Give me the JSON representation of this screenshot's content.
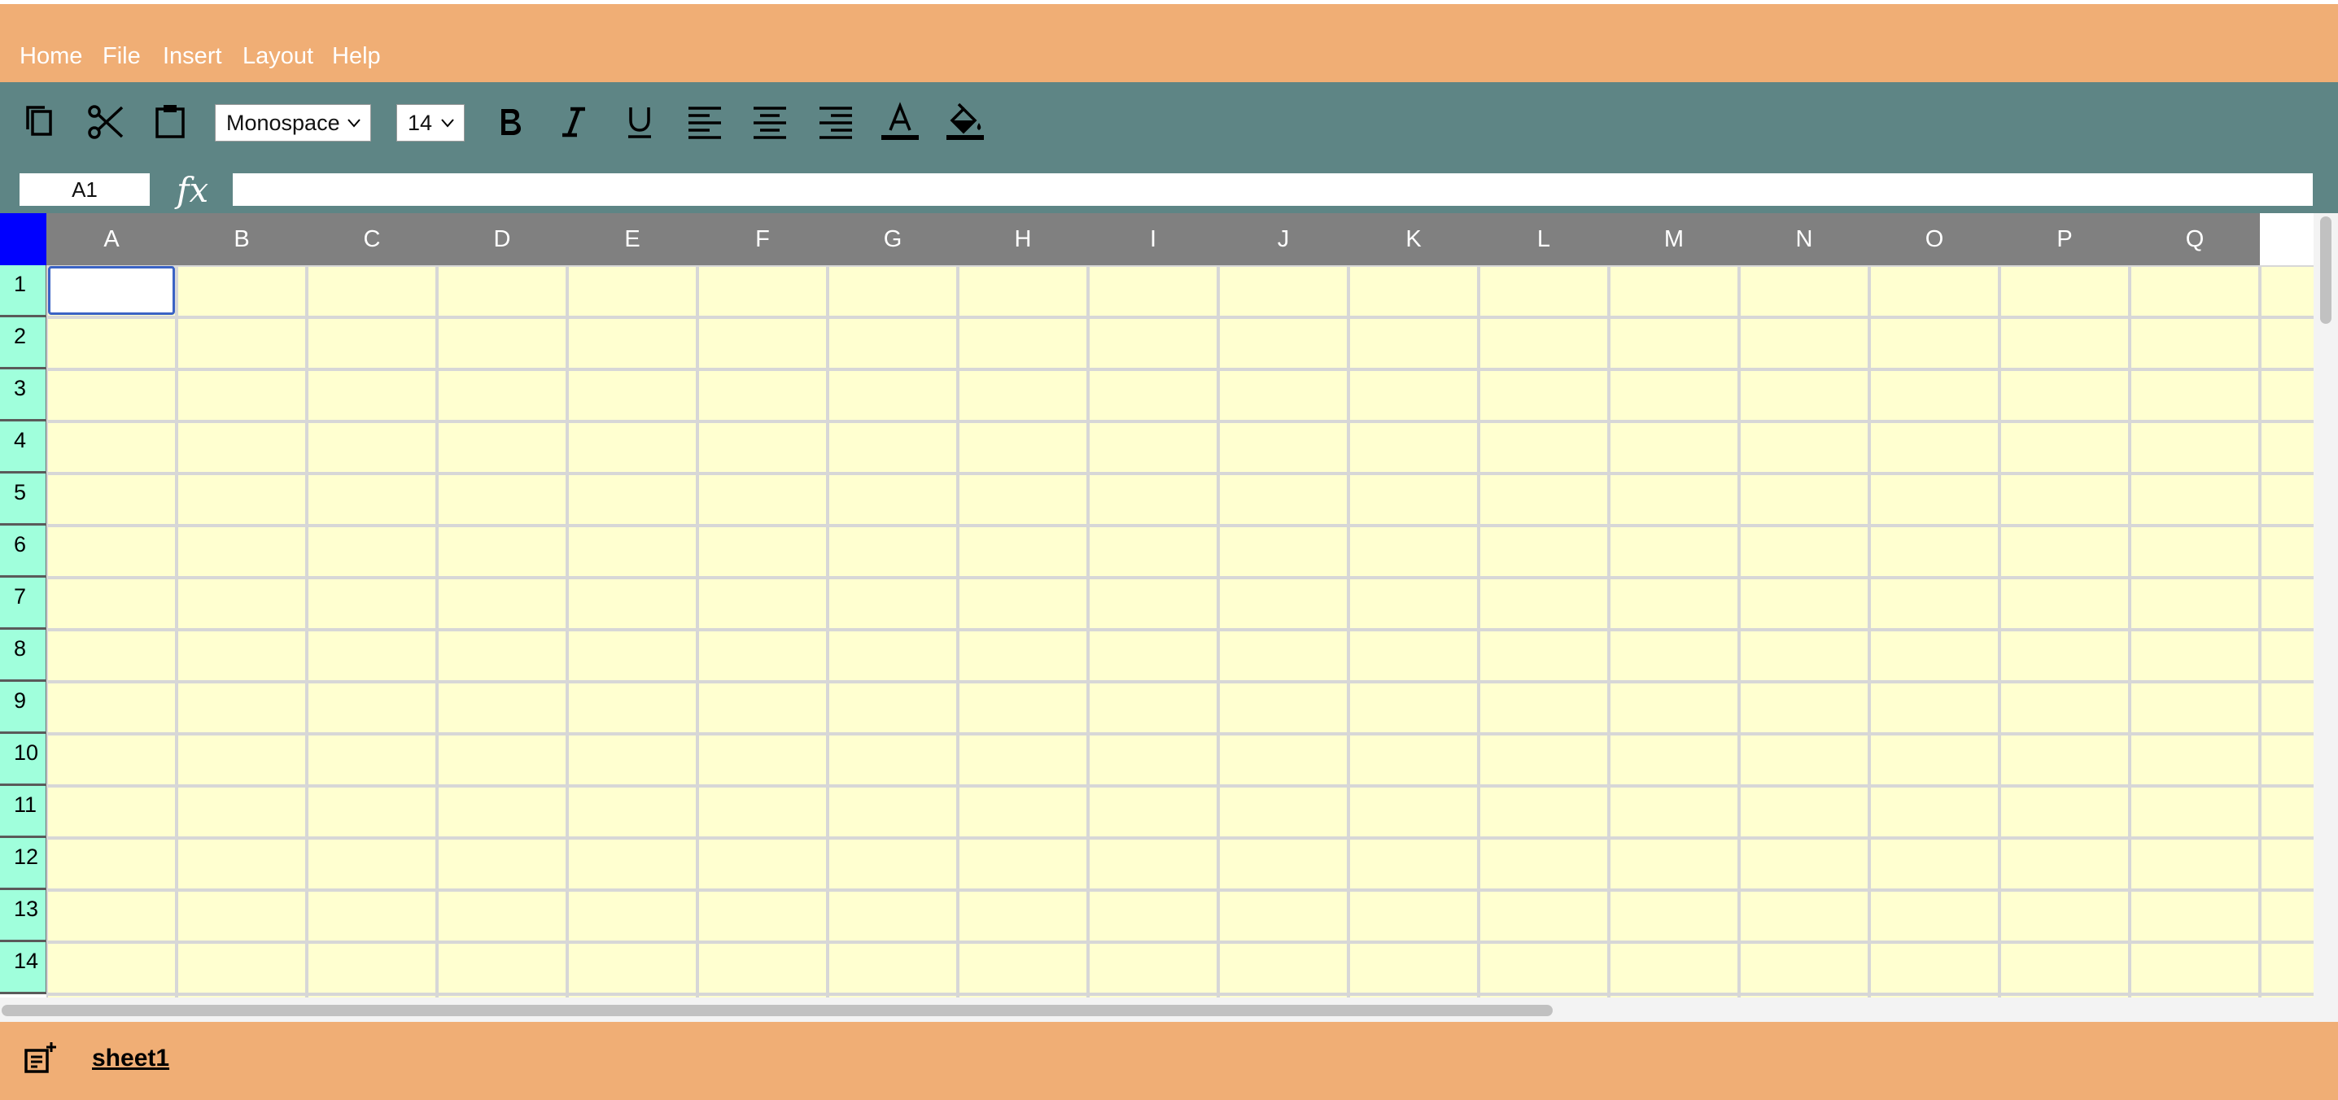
{
  "menu": {
    "items": [
      "Home",
      "File",
      "Insert",
      "Layout",
      "Help"
    ]
  },
  "toolbar": {
    "font_family": "Monospace",
    "font_size": "14",
    "icons": [
      "copy-icon",
      "cut-icon",
      "paste-icon",
      "bold-icon",
      "italic-icon",
      "underline-icon",
      "align-left-icon",
      "align-center-icon",
      "align-right-icon",
      "text-color-icon",
      "fill-color-icon"
    ]
  },
  "formula_bar": {
    "cell_ref": "A1",
    "fx_label": "fx",
    "formula": ""
  },
  "grid": {
    "columns": [
      "A",
      "B",
      "C",
      "D",
      "E",
      "F",
      "G",
      "H",
      "I",
      "J",
      "K",
      "L",
      "M",
      "N",
      "O",
      "P",
      "Q"
    ],
    "rows": [
      "1",
      "2",
      "3",
      "4",
      "5",
      "6",
      "7",
      "8",
      "9",
      "10",
      "11",
      "12",
      "13",
      "14"
    ],
    "selected_cell": "A1"
  },
  "sheets": {
    "tabs": [
      "sheet1"
    ]
  },
  "colors": {
    "menubar": "#f0ae75",
    "toolbar": "#5e8585",
    "column_header": "#808080",
    "row_header": "#a0ffdc",
    "corner": "#0000ff",
    "cell_background": "#ffffd0",
    "selection": "#3b63c4"
  }
}
